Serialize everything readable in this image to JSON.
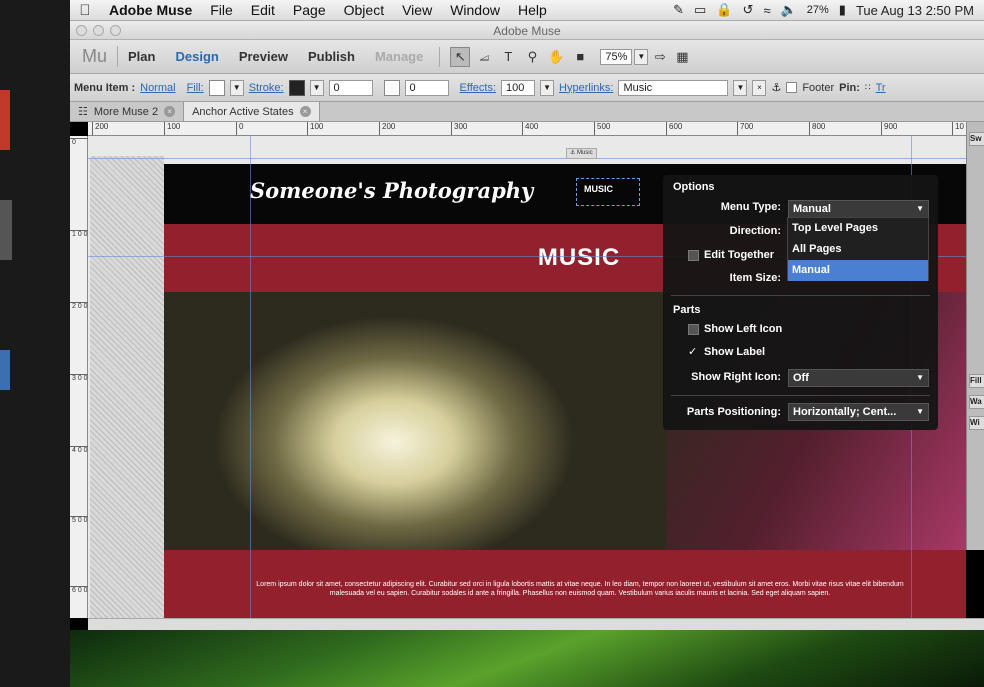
{
  "menubar": {
    "app": "Adobe Muse",
    "items": [
      "File",
      "Edit",
      "Page",
      "Object",
      "View",
      "Window",
      "Help"
    ],
    "battery": "27%",
    "clock": "Tue Aug 13  2:50 PM"
  },
  "window": {
    "title": "Adobe Muse"
  },
  "modebar": {
    "logo": "Mu",
    "modes": [
      "Plan",
      "Design",
      "Preview",
      "Publish",
      "Manage"
    ],
    "zoom": "75%"
  },
  "controlbar": {
    "menu_item_label": "Menu Item :",
    "state": "Normal",
    "fill": "Fill:",
    "stroke": "Stroke:",
    "stroke_value": "0",
    "spacing_value": "0",
    "effects": "Effects:",
    "effects_value": "100",
    "hyperlinks": "Hyperlinks:",
    "hyperlink_value": "Music",
    "footer": "Footer",
    "pin": "Pin:",
    "tr": "Tr"
  },
  "tabs": [
    {
      "label": "More Muse 2"
    },
    {
      "label": "Anchor Active States"
    }
  ],
  "ruler": {
    "h": [
      "200",
      "100",
      "0",
      "100",
      "200",
      "300",
      "400",
      "500",
      "600",
      "700",
      "800",
      "900",
      "10"
    ],
    "v": [
      "0",
      "1 0 0",
      "2 0 0",
      "3 0 0",
      "4 0 0",
      "5 0 0",
      "6 0 0"
    ]
  },
  "site": {
    "logo": "Someone's Photography",
    "nav_item": "MUSIC",
    "banner": "MUSIC",
    "anchor_label": "Music",
    "lorem": "Lorem ipsum dolor sit amet, consectetur adipiscing elit. Curabitur sed orci in ligula lobortis mattis at vitae neque. In leo diam, tempor non laoreet ut, vestibulum sit amet eros. Morbi vitae risus vitae elit bibendum malesuada vel eu sapien. Curabitur sodales id ante a fringilla. Phasellus non euismod quam. Vestibulum varius iaculis mauris et lacinia. Sed eget aliquam sapien."
  },
  "options_panel": {
    "title": "Options",
    "menu_type_label": "Menu Type:",
    "menu_type_value": "Manual",
    "menu_type_options": [
      "Top Level Pages",
      "All Pages",
      "Manual"
    ],
    "direction_label": "Direction:",
    "edit_together": "Edit Together",
    "item_size_label": "Item Size:",
    "parts_title": "Parts",
    "show_left_icon": "Show Left Icon",
    "show_label": "Show Label",
    "show_right_icon_label": "Show Right Icon:",
    "show_right_icon_value": "Off",
    "parts_positioning_label": "Parts Positioning:",
    "parts_positioning_value": "Horizontally; Cent..."
  },
  "right_panel": {
    "tabs": [
      "Sw",
      "Fill",
      "Wa",
      "Wi"
    ]
  }
}
